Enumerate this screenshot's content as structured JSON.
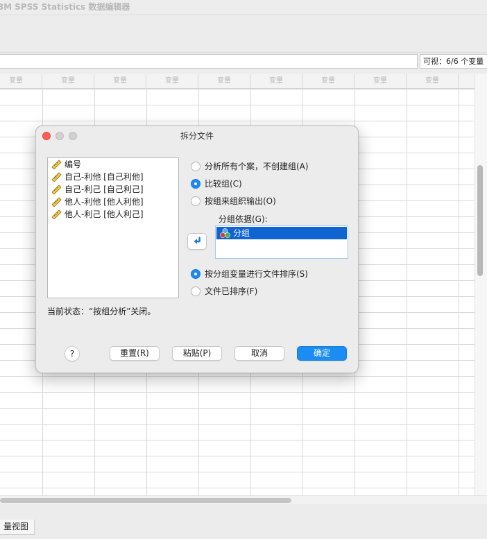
{
  "app": {
    "title": "BM SPSS Statistics 数据编辑器"
  },
  "cellbar": {
    "visible_status": "可视：6/6 个变量"
  },
  "grid": {
    "column_header": "变量"
  },
  "bottom_tabs": {
    "variable_view": "量视图"
  },
  "dialog": {
    "title": "拆分文件",
    "variables": [
      {
        "label": "编号",
        "icon": "scale-ruler-icon"
      },
      {
        "label": "自己-利他 [自己利他]",
        "icon": "scale-ruler-icon"
      },
      {
        "label": "自己-利己 [自己利己]",
        "icon": "scale-ruler-icon"
      },
      {
        "label": "他人-利他 [他人利他]",
        "icon": "scale-ruler-icon"
      },
      {
        "label": "他人-利己 [他人利己]",
        "icon": "scale-ruler-icon"
      }
    ],
    "current_state": "当前状态：“按组分析”关闭。",
    "options": {
      "analyze_all": {
        "label": "分析所有个案，不创建组(A)",
        "checked": false
      },
      "compare_groups": {
        "label": "比较组(C)",
        "checked": true
      },
      "organize_output": {
        "label": "按组来组织输出(O)",
        "checked": false
      }
    },
    "group_by": {
      "label": "分组依据(G):",
      "items": [
        {
          "label": "分组",
          "icon": "nominal-icon"
        }
      ]
    },
    "sort": {
      "sort_by_group": {
        "label": "按分组变量进行文件排序(S)",
        "checked": true
      },
      "already_sorted": {
        "label": "文件已排序(F)",
        "checked": false
      }
    },
    "buttons": {
      "help": "?",
      "reset": "重置(R)",
      "paste": "粘贴(P)",
      "cancel": "取消",
      "ok": "确定"
    }
  },
  "colors": {
    "accent": "#1a8cf2",
    "selection": "#0f64d2",
    "close_button": "#ff5f57"
  }
}
